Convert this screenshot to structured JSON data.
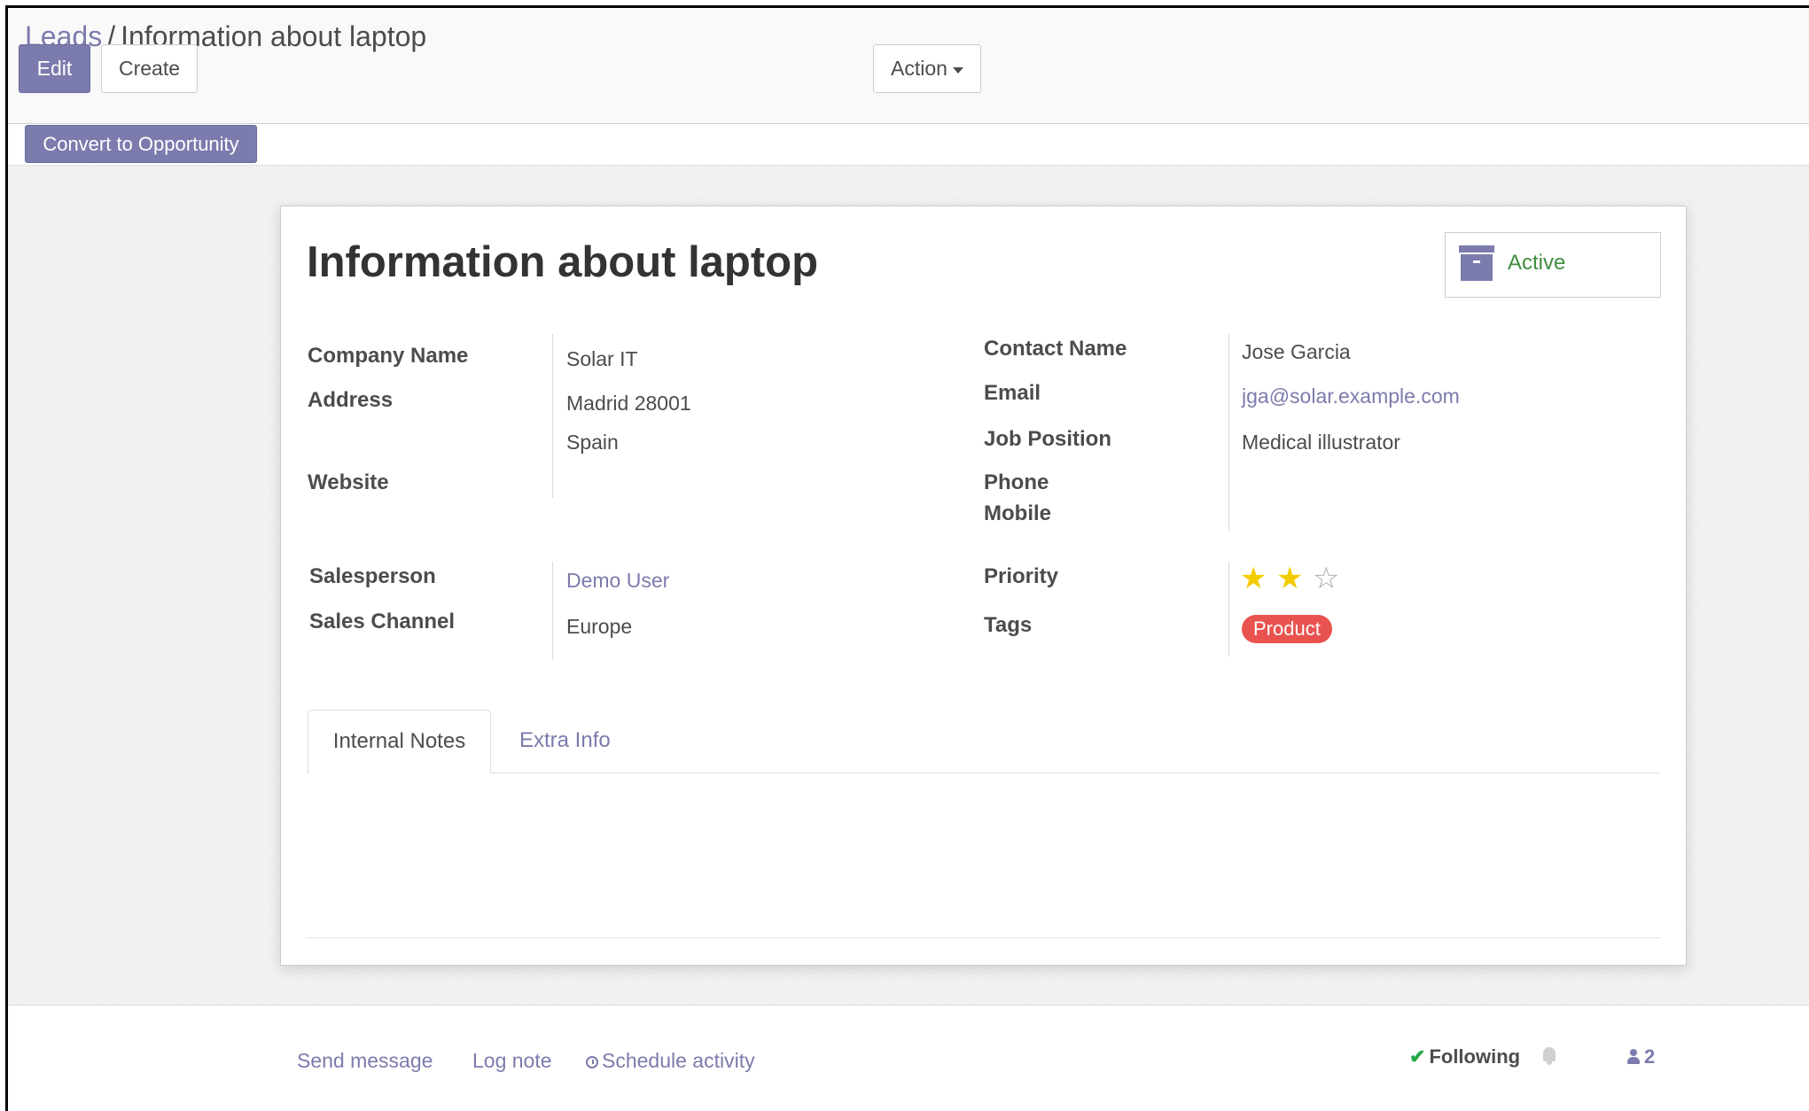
{
  "breadcrumb": {
    "parent": "Leads",
    "separator": "/",
    "current": "Information about laptop"
  },
  "toolbar": {
    "edit": "Edit",
    "create": "Create",
    "action": "Action"
  },
  "statusbar": {
    "convert": "Convert to Opportunity"
  },
  "record": {
    "title": "Information about laptop",
    "archive_status": "Active",
    "company_label": "Company Name",
    "company_value": "Solar IT",
    "address_label": "Address",
    "address_line1": "Madrid 28001",
    "address_line2": "Spain",
    "website_label": "Website",
    "contact_label": "Contact Name",
    "contact_value": "Jose Garcia",
    "email_label": "Email",
    "email_value": "jga@solar.example.com",
    "job_label": "Job Position",
    "job_value": "Medical illustrator",
    "phone_label": "Phone",
    "mobile_label": "Mobile",
    "salesperson_label": "Salesperson",
    "salesperson_value": "Demo User",
    "channel_label": "Sales Channel",
    "channel_value": "Europe",
    "priority_label": "Priority",
    "priority_value": 2,
    "priority_max": 3,
    "tags_label": "Tags",
    "tags": [
      "Product"
    ],
    "colors": {
      "accent": "#7c7bad",
      "tag": "#e9534f",
      "star": "#f3cc00",
      "active": "#3e8e3e"
    }
  },
  "tabs": {
    "internal_notes": "Internal Notes",
    "extra_info": "Extra Info"
  },
  "chatter": {
    "send_message": "Send message",
    "log_note": "Log note",
    "schedule_activity": "Schedule activity",
    "following": "Following",
    "followers_count": "2",
    "icons": [
      "clock-icon",
      "check-icon",
      "bell-icon",
      "user-icon"
    ]
  }
}
